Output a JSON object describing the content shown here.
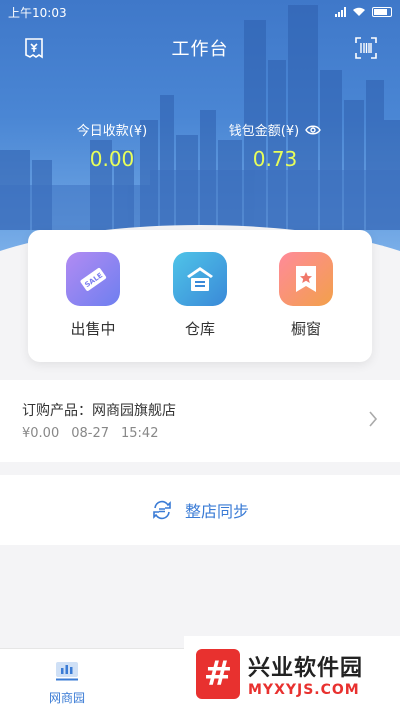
{
  "status_bar": {
    "time": "上午10:03"
  },
  "header": {
    "title": "工作台",
    "left_icon": "receipt-icon",
    "right_icon": "barcode-scan-icon"
  },
  "stats": {
    "today_income": {
      "label": "今日收款(¥)",
      "value": "0.00"
    },
    "wallet": {
      "label": "钱包金额(¥)",
      "value": "0.73",
      "icon": "eye-icon"
    }
  },
  "shortcuts": [
    {
      "label": "出售中",
      "icon": "sale-tag-icon",
      "color": "#8a7ff0"
    },
    {
      "label": "仓库",
      "icon": "warehouse-icon",
      "color": "#3a89d8"
    },
    {
      "label": "橱窗",
      "icon": "star-bookmark-icon",
      "color": "#f2905a"
    }
  ],
  "order": {
    "title": "订购产品：网商园旗舰店",
    "price": "¥0.00",
    "date": "08-27",
    "time": "15:42"
  },
  "sync": {
    "label": "整店同步",
    "icon": "sync-icon"
  },
  "tabbar": {
    "items": [
      {
        "label": "网商园",
        "icon": "chart-icon",
        "active": true
      }
    ]
  },
  "watermark": {
    "name": "兴业软件园",
    "domain": "MYXYJS.COM",
    "logo_char": "#"
  },
  "colors": {
    "accent": "#3a7bd5",
    "value_highlight": "#e8ff5a"
  }
}
